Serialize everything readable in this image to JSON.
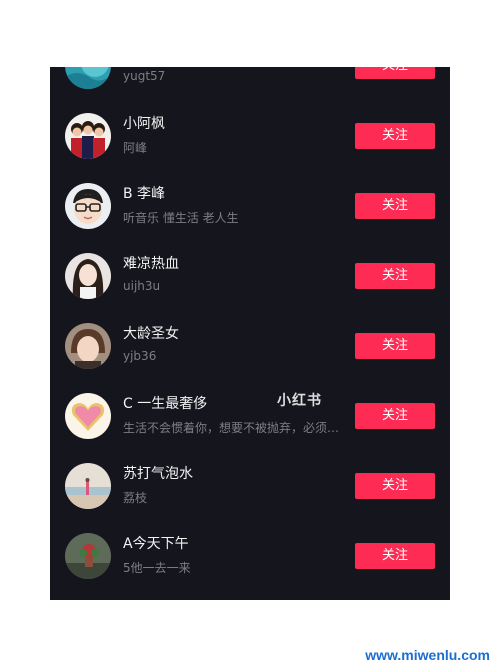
{
  "list": {
    "follow_label": "关注",
    "items": [
      {
        "name": "",
        "sub": "yugt57",
        "avatar": "ocean-photo-avatar"
      },
      {
        "name": "小阿枫",
        "sub": "阿峰",
        "avatar": "group-photo-avatar"
      },
      {
        "name": "B 李峰",
        "sub": "听音乐 懂生活 老人生",
        "avatar": "cartoon-glasses-avatar"
      },
      {
        "name": "难凉热血",
        "sub": "uijh3u",
        "avatar": "portrait-avatar"
      },
      {
        "name": "大龄圣女",
        "sub": "yjb36",
        "avatar": "portrait-avatar"
      },
      {
        "name": "C 一生最奢侈",
        "sub": "生活不会惯着你，想要不被抛弃，必须自己强大",
        "avatar": "love-heart-avatar"
      },
      {
        "name": "苏打气泡水",
        "sub": "荔枝",
        "avatar": "beach-photo-avatar"
      },
      {
        "name": "A今天下午",
        "sub": "5他一去一来",
        "avatar": "plant-photo-avatar"
      }
    ]
  },
  "watermark": "小红书",
  "site_watermark": "www.miwenlu.com",
  "colors": {
    "background": "#15151e",
    "follow_button": "#fe2c55",
    "name_text": "#f2f2f2",
    "sub_text": "#7d7d86"
  }
}
